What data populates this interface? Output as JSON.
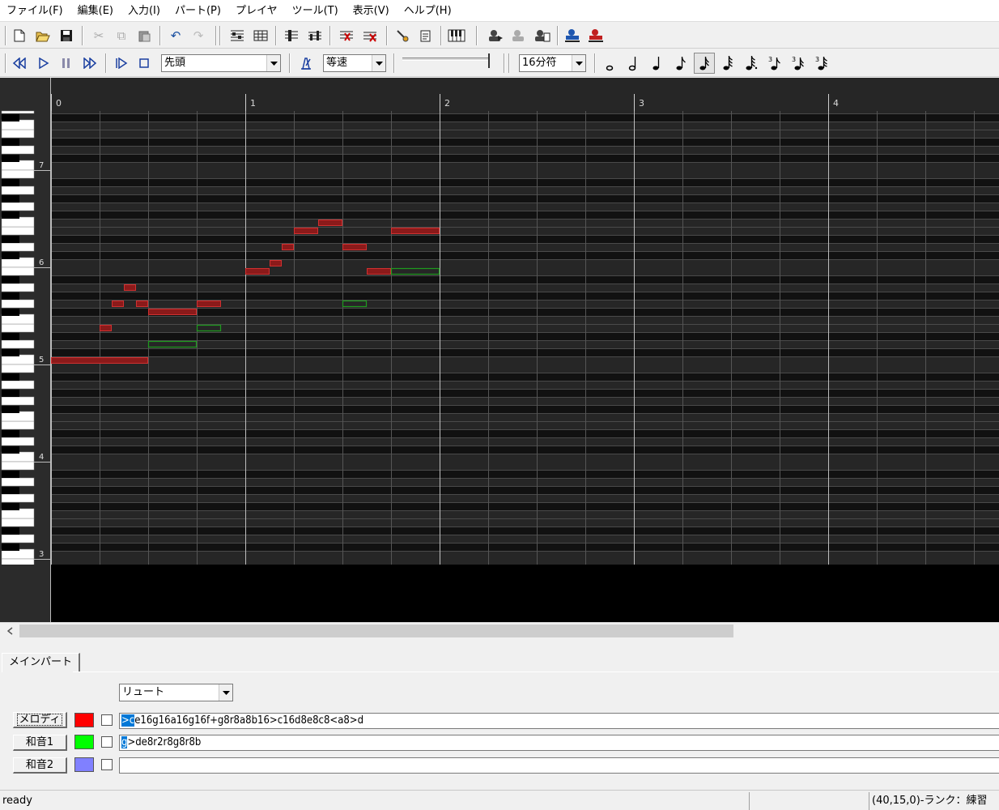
{
  "menu": [
    "ファイル(F)",
    "編集(E)",
    "入力(I)",
    "パート(P)",
    "プレイヤ",
    "ツール(T)",
    "表示(V)",
    "ヘルプ(H)"
  ],
  "toolbar": {
    "position_select": "先頭",
    "speed_select": "等速",
    "quantize_select": "16分符"
  },
  "ruler": {
    "measures": [
      "0",
      "1",
      "2",
      "3",
      "4"
    ]
  },
  "piano": {
    "octaves": [
      "7",
      "6",
      "5",
      "4",
      "3"
    ]
  },
  "roll": {
    "note_fill_red": "#8b1a1a",
    "note_border_red": "#c83030",
    "note_border_green": "#1e8c1e",
    "grid_bg": "#000000"
  },
  "bottom": {
    "tab_label": "メインパート",
    "instrument": "リュート",
    "parts": [
      {
        "label": "メロディ",
        "color": "#ff0000",
        "mml_selected": ">c",
        "mml_rest": "e16g16a16g16f+g8r8a8b16>c16d8e8c8<a8>d"
      },
      {
        "label": "和音1",
        "color": "#00ff00",
        "mml_selected": "g",
        "mml_rest": ">de8r2r8g8r8b"
      },
      {
        "label": "和音2",
        "color": "#8080ff",
        "mml_selected": "",
        "mml_rest": ""
      }
    ]
  },
  "status": {
    "left": "ready",
    "right": "(40,15,0)-ランク：練習"
  }
}
